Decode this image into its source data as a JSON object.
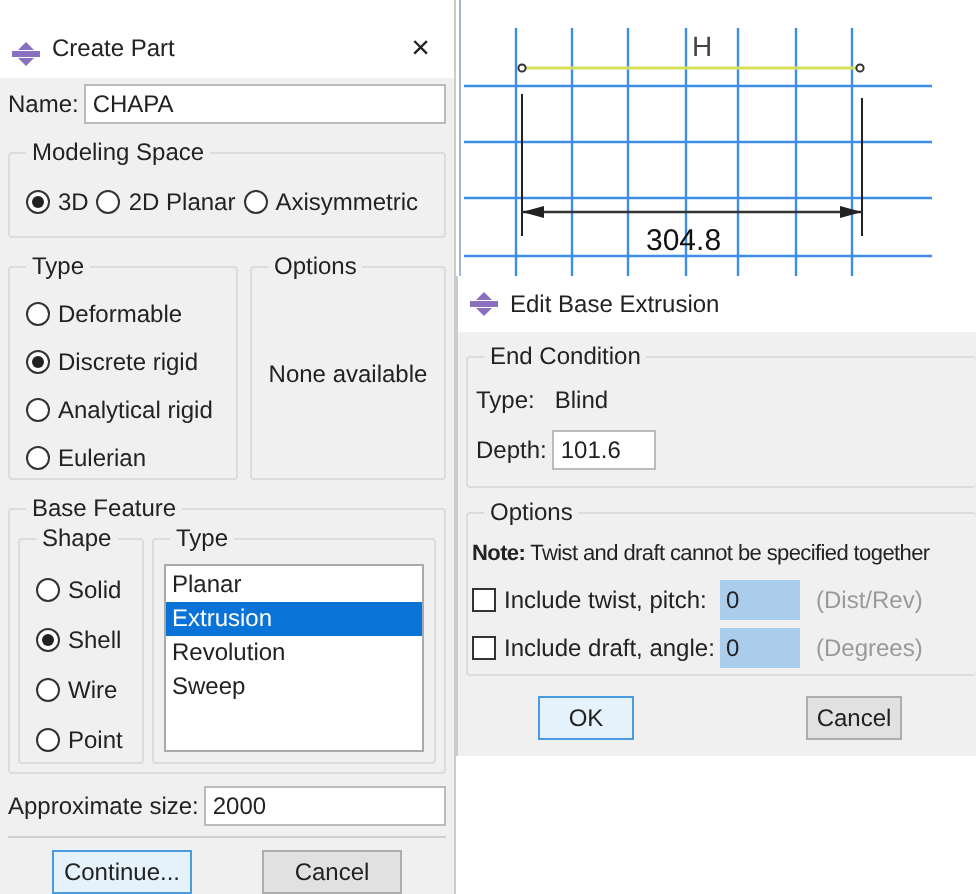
{
  "create_part": {
    "title": "Create Part",
    "close": "×",
    "name_label": "Name:",
    "name_value": "CHAPA",
    "modeling_space": {
      "title": "Modeling Space",
      "options": [
        {
          "label": "3D",
          "selected": true
        },
        {
          "label": "2D Planar",
          "selected": false
        },
        {
          "label": "Axisymmetric",
          "selected": false
        }
      ]
    },
    "type": {
      "title": "Type",
      "options": [
        {
          "label": "Deformable",
          "selected": false
        },
        {
          "label": "Discrete rigid",
          "selected": true
        },
        {
          "label": "Analytical rigid",
          "selected": false
        },
        {
          "label": "Eulerian",
          "selected": false
        }
      ]
    },
    "options": {
      "title": "Options",
      "text": "None available"
    },
    "base_feature": {
      "title": "Base Feature",
      "shape": {
        "title": "Shape",
        "options": [
          {
            "label": "Solid",
            "selected": false
          },
          {
            "label": "Shell",
            "selected": true
          },
          {
            "label": "Wire",
            "selected": false
          },
          {
            "label": "Point",
            "selected": false
          }
        ]
      },
      "type": {
        "title": "Type",
        "items": [
          {
            "label": "Planar",
            "selected": false
          },
          {
            "label": "Extrusion",
            "selected": true
          },
          {
            "label": "Revolution",
            "selected": false
          },
          {
            "label": "Sweep",
            "selected": false
          }
        ]
      }
    },
    "approximate_size": {
      "label": "Approximate size:",
      "value": "2000"
    },
    "buttons": [
      {
        "label": "Continue...",
        "default": true
      },
      {
        "label": "Cancel",
        "default": false
      }
    ]
  },
  "sketch": {
    "top_label": "H",
    "dimension": "304.8"
  },
  "edit_base_extrusion": {
    "title": "Edit Base Extrusion",
    "end_condition": {
      "title": "End Condition",
      "type_label": "Type:",
      "type_value": "Blind",
      "depth_label": "Depth:",
      "depth_value": "101.6"
    },
    "options": {
      "title": "Options",
      "note_label": "Note:",
      "note": "Twist and draft cannot be specified together",
      "rows": [
        {
          "label": "Include twist, pitch:",
          "checked": false,
          "value": "0",
          "unit": "(Dist/Rev)"
        },
        {
          "label": "Include draft, angle:",
          "checked": false,
          "value": "0",
          "unit": "(Degrees)"
        }
      ]
    },
    "buttons": [
      {
        "label": "OK",
        "default": true
      },
      {
        "label": "Cancel",
        "default": false
      }
    ]
  }
}
